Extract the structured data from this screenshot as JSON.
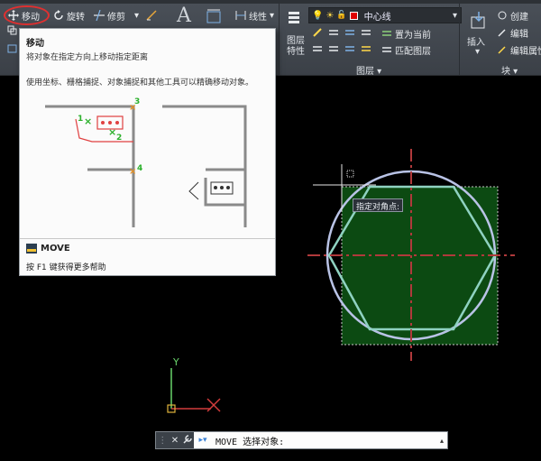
{
  "ribbon": {
    "move_label": "移动",
    "rotate_label": "旋转",
    "trim_label": "修剪",
    "dropdown_arrow": "▾",
    "linetype_label": "线性",
    "layer_name": "中心线",
    "set_current_label": "置为当前",
    "match_layer_label": "匹配图层",
    "layer_props_label": "图层\n特性",
    "layer_props_line1": "图层",
    "layer_props_line2": "特性",
    "insert_label": "插入",
    "create_label": "创建",
    "edit_label": "编辑",
    "edit_attr_label": "编辑属性",
    "panel_layers": "图层 ▾",
    "panel_block": "块 ▾",
    "colors": {
      "accent_red": "#e03030",
      "layer_red": "#e00000"
    }
  },
  "tooltip": {
    "title": "移动",
    "description": "将对象在指定方向上移动指定距离",
    "extra": "使用坐标、栅格捕捉、对象捕捉和其他工具可以精确移动对象。",
    "labels": [
      "1",
      "2",
      "3",
      "4"
    ],
    "command": "MOVE",
    "help": "按 F1 键获得更多帮助"
  },
  "canvas": {
    "hint_text": "指定对角点:",
    "ucs_y": "Y",
    "colors": {
      "selection_fill": "#0c4a12",
      "circle": "#b9c3e6",
      "hexagon": "#8fd2c1",
      "centerline": "#b0393b"
    }
  },
  "command_line": {
    "value": "MOVE 选择对象:",
    "close_icon": "✕",
    "wrench_icon": "🔧"
  }
}
